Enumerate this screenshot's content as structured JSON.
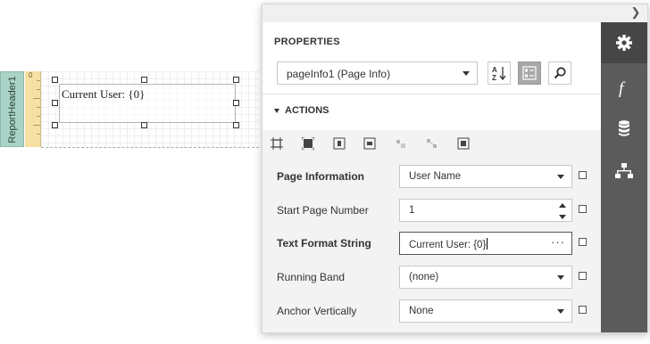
{
  "canvas": {
    "band_label": "ReportHeader1",
    "ruler_mark": "0",
    "control_text": "Current User: {0}"
  },
  "panel": {
    "collapse_icon": "chevron-right-icon",
    "section_title": "PROPERTIES",
    "component_selector": "pageInfo1 (Page Info)",
    "sort_button_icon": "sort-alphabetical-icon",
    "categories_button_icon": "categorized-view-icon",
    "search_button_icon": "search-icon",
    "actions_label": "ACTIONS",
    "action_icons": [
      "fit-bounds-icon",
      "fit-to-container-icon",
      "center-horizontally-icon",
      "center-vertically-icon",
      "align-to-grid-icon",
      "size-to-grid-icon",
      "bring-to-front-icon"
    ],
    "properties": [
      {
        "label": "Page Information",
        "value": "User Name",
        "bold": true,
        "editor": "dropdown"
      },
      {
        "label": "Start Page Number",
        "value": "1",
        "bold": false,
        "editor": "spin"
      },
      {
        "label": "Text Format String",
        "value": "Current User: {0}",
        "bold": true,
        "editor": "ellipsis"
      },
      {
        "label": "Running Band",
        "value": "(none)",
        "bold": false,
        "editor": "dropdown"
      },
      {
        "label": "Anchor Vertically",
        "value": "None",
        "bold": false,
        "editor": "dropdown"
      }
    ],
    "ellipsis_label": "···"
  },
  "sidebar": {
    "tabs": [
      {
        "name": "properties-tab",
        "icon": "gear-icon",
        "active": true
      },
      {
        "name": "expressions-tab",
        "icon": "function-icon",
        "active": false
      },
      {
        "name": "field-list-tab",
        "icon": "database-icon",
        "active": false
      },
      {
        "name": "report-explorer-tab",
        "icon": "hierarchy-icon",
        "active": false
      }
    ]
  },
  "colors": {
    "band_tab": "#a9d3c6",
    "ruler": "#f7e0a3",
    "sidebar": "#5b5b5b",
    "sidebar_active": "#464646",
    "actions_bg": "#f3f3f3"
  }
}
